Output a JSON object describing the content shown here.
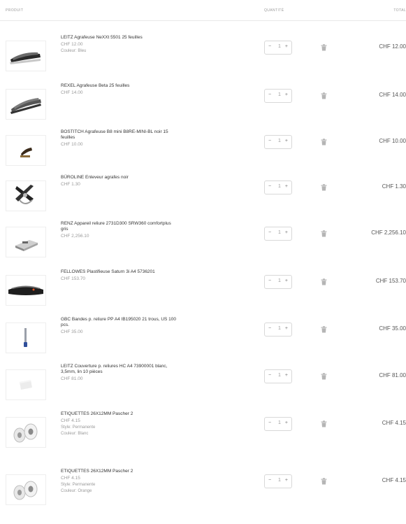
{
  "header": {
    "product": "PRODUIT",
    "quantity": "QUANTITÉ",
    "total": "TOTAL"
  },
  "items": [
    {
      "name": "LEITZ Agrafeuse NeXXt 5501 25 feuilles",
      "price": "CHF 12.00",
      "options": [
        "Couleur: Bleu"
      ],
      "quantity": "1",
      "total": "CHF 12.00"
    },
    {
      "name": "REXEL Agrafeuse Beta 25 feuilles",
      "price": "CHF 14.00",
      "options": [],
      "quantity": "1",
      "total": "CHF 14.00"
    },
    {
      "name": "BOSTITCH Agrafeuse B8 mini B8RE-MINI-BL noir 15 feuilles",
      "price": "CHF 10.00",
      "options": [],
      "quantity": "1",
      "total": "CHF 10.00"
    },
    {
      "name": "BÜROLINE Enleveur agrafes noir",
      "price": "CHF 1.30",
      "options": [],
      "quantity": "1",
      "total": "CHF 1.30"
    },
    {
      "name": "RENZ Appareil reliure 2731D300 SRW360 comfortplus gris",
      "price": "CHF 2,256.10",
      "options": [],
      "quantity": "1",
      "total": "CHF 2,256.10"
    },
    {
      "name": "FELLOWES Plastifieuse Saturn 3i A4 5736201",
      "price": "CHF 153.70",
      "options": [],
      "quantity": "1",
      "total": "CHF 153.70"
    },
    {
      "name": "GBC Bandes p. reliure PP A4 IB195020 21 trous, US 100 pcs.",
      "price": "CHF 35.00",
      "options": [],
      "quantity": "1",
      "total": "CHF 35.00"
    },
    {
      "name": "LEITZ Couverture p. reliures HC A4 73900001 blanc, 3,5mm, lin 10 pièces",
      "price": "CHF 81.00",
      "options": [],
      "quantity": "1",
      "total": "CHF 81.00"
    },
    {
      "name": "ETIQUETTES 26X12MM Pascher 2",
      "price": "CHF 4.15",
      "options": [
        "Style: Permanente",
        "Couleur: Blanc"
      ],
      "quantity": "1",
      "total": "CHF 4.15"
    },
    {
      "name": "ETIQUETTES 26X12MM Pascher 2",
      "price": "CHF 4.15",
      "options": [
        "Style: Permanente",
        "Couleur: Orange"
      ],
      "quantity": "1",
      "total": "CHF 4.15"
    }
  ],
  "controls": {
    "minus": "−",
    "plus": "+"
  },
  "icons": {
    "remove": "trash-icon"
  },
  "colors": {
    "border": "#d8d8d8",
    "muted": "#9a9a9a",
    "text": "#333333"
  }
}
